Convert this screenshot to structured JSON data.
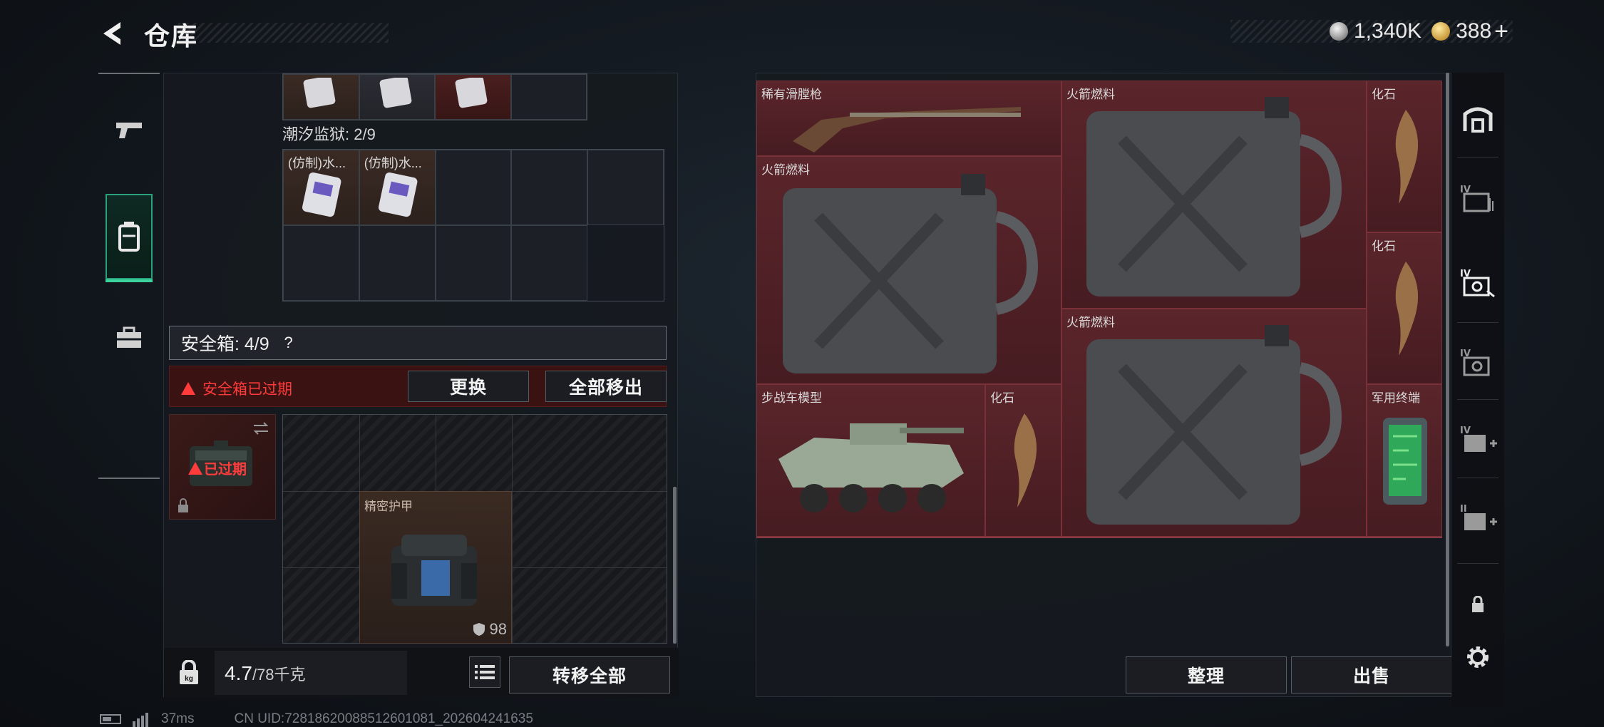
{
  "header": {
    "title": "仓库",
    "silver_amount": "1,340K",
    "gold_amount": "388",
    "gold_plus": "+"
  },
  "left_panel": {
    "prison_label": "潮汐监狱: 2/9",
    "prison_items": [
      {
        "label": "(仿制)水..."
      },
      {
        "label": "(仿制)水..."
      }
    ],
    "safebox_label": "安全箱: 4/9",
    "safebox_help": "?",
    "expired_warning": "安全箱已过期",
    "replace_button": "更换",
    "remove_all_button": "全部移出",
    "safebox_thumb_status": "已过期",
    "armor_label": "精密护甲",
    "armor_durability": "98",
    "weight_current": "4.7",
    "weight_max": "/78千克",
    "transfer_all_button": "转移全部"
  },
  "stash": {
    "items": [
      {
        "label": "稀有滑膛枪"
      },
      {
        "label": "火箭燃料"
      },
      {
        "label": "化石"
      },
      {
        "label": "火箭燃料"
      },
      {
        "label": "化石"
      },
      {
        "label": "火箭燃料"
      },
      {
        "label": "步战车模型"
      },
      {
        "label": "化石"
      },
      {
        "label": "军用终端"
      }
    ],
    "organize_button": "整理",
    "sell_button": "出售"
  },
  "footer": {
    "ping": "37ms",
    "uid": "CN UID:7281862008851260108​1_202604241635"
  },
  "colors": {
    "accent_green": "#2aa07c",
    "warning_red": "#ff3b3b",
    "stash_red": "#4a1f24"
  }
}
